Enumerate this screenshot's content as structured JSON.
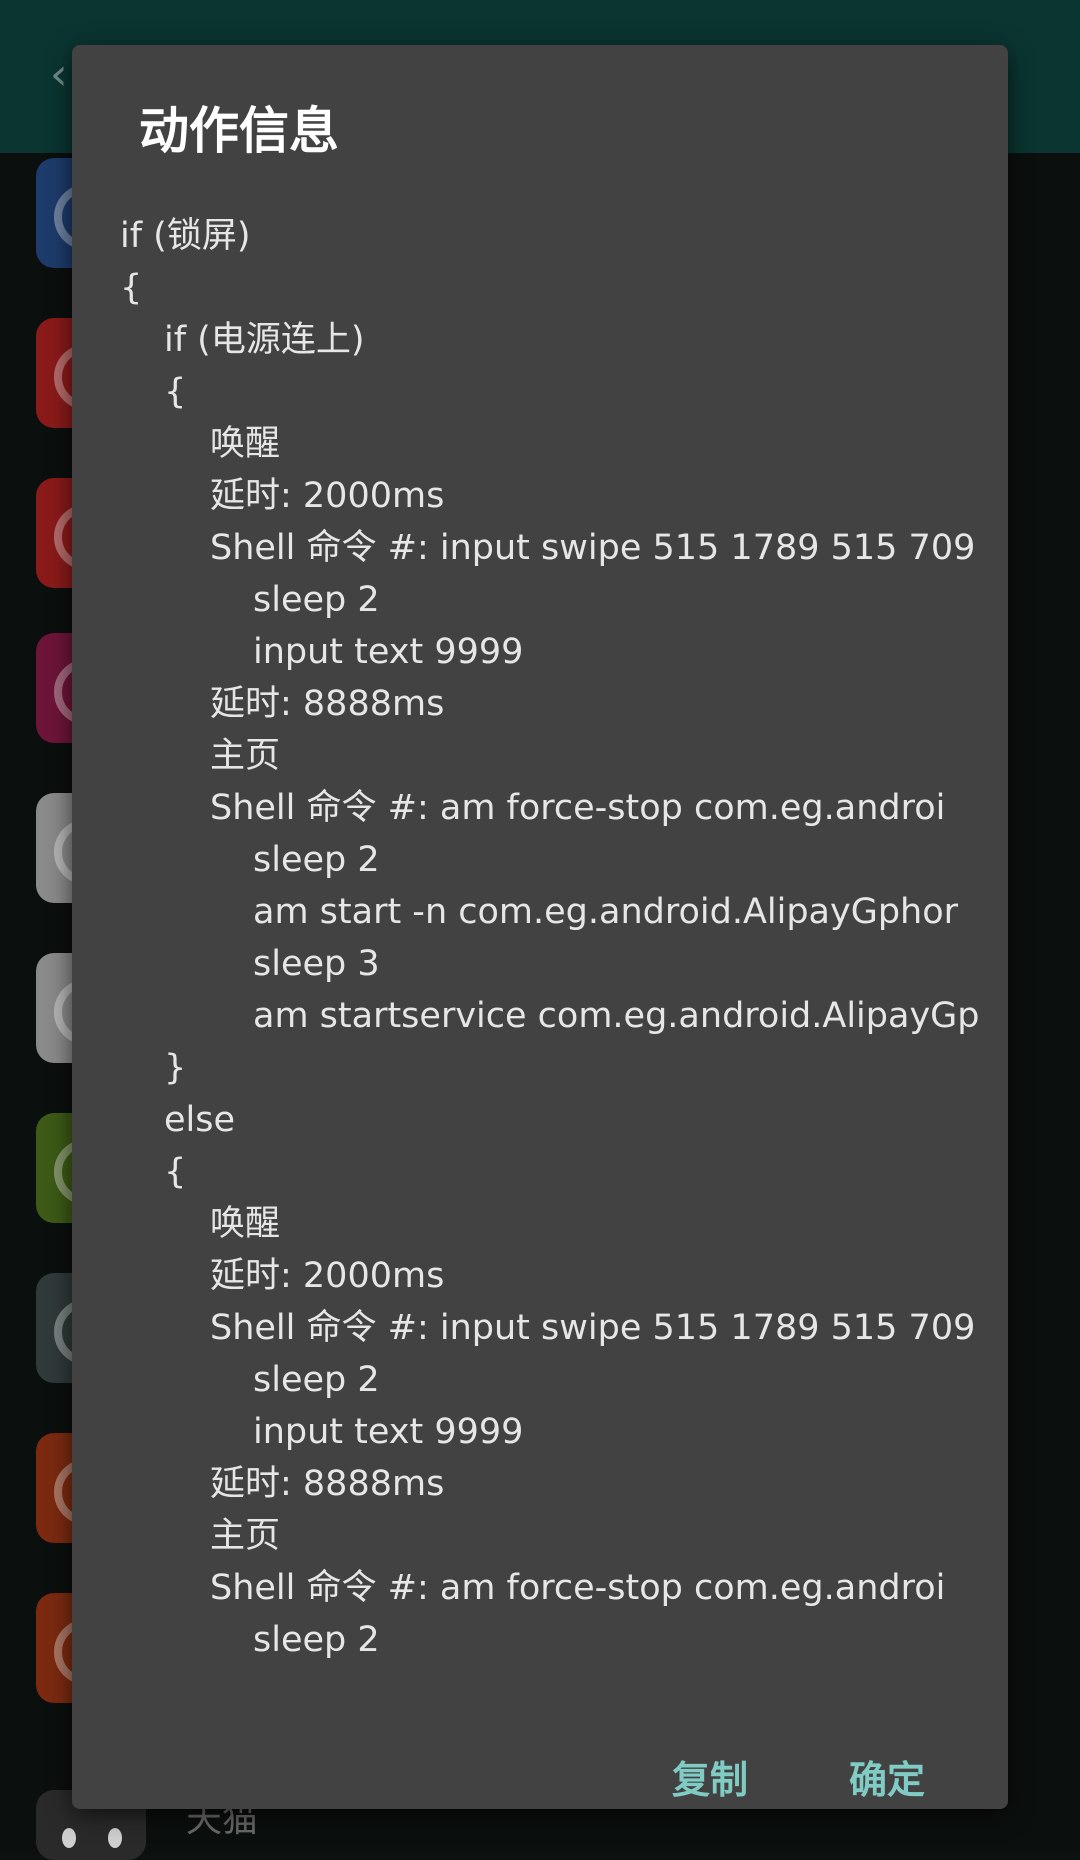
{
  "background": {
    "bottom_item_label": "天猫",
    "icon_colors": [
      "#1d3b6b",
      "#8b1a1a",
      "#8b1a1a",
      "#6d1538",
      "#8a8a8a",
      "#8a8a8a",
      "#3d5a16",
      "#2f3a3a",
      "#7b2a10",
      "#7b2a10"
    ]
  },
  "dialog": {
    "title": "动作信息",
    "lines": [
      {
        "indent": 0,
        "text": "if (锁屏)"
      },
      {
        "indent": 0,
        "text": "{"
      },
      {
        "indent": 1,
        "text": "if (电源连上)"
      },
      {
        "indent": 1,
        "text": "{"
      },
      {
        "indent": 2,
        "text": "唤醒"
      },
      {
        "indent": 2,
        "text": "延时: 2000ms"
      },
      {
        "indent": 2,
        "text": "Shell 命令 #: input swipe 515 1789 515 709"
      },
      {
        "indent": 3,
        "text": "sleep 2"
      },
      {
        "indent": 3,
        "text": "input text 9999"
      },
      {
        "indent": 2,
        "text": "延时: 8888ms"
      },
      {
        "indent": 2,
        "text": "主页"
      },
      {
        "indent": 2,
        "text": "Shell 命令 #: am force-stop com.eg.androi"
      },
      {
        "indent": 3,
        "text": "sleep 2"
      },
      {
        "indent": 3,
        "text": "am start -n com.eg.android.AlipayGphor"
      },
      {
        "indent": 3,
        "text": "sleep 3"
      },
      {
        "indent": 3,
        "text": "am startservice com.eg.android.AlipayGp"
      },
      {
        "indent": 1,
        "text": "}"
      },
      {
        "indent": 1,
        "text": "else"
      },
      {
        "indent": 1,
        "text": "{"
      },
      {
        "indent": 2,
        "text": "唤醒"
      },
      {
        "indent": 2,
        "text": "延时: 2000ms"
      },
      {
        "indent": 2,
        "text": "Shell 命令 #: input swipe 515 1789 515 709"
      },
      {
        "indent": 3,
        "text": "sleep 2"
      },
      {
        "indent": 3,
        "text": "input text 9999"
      },
      {
        "indent": 2,
        "text": "延时: 8888ms"
      },
      {
        "indent": 2,
        "text": "主页"
      },
      {
        "indent": 2,
        "text": "Shell 命令 #: am force-stop com.eg.androi"
      },
      {
        "indent": 3,
        "text": "sleep 2"
      }
    ],
    "copy_label": "复制",
    "ok_label": "确定"
  }
}
